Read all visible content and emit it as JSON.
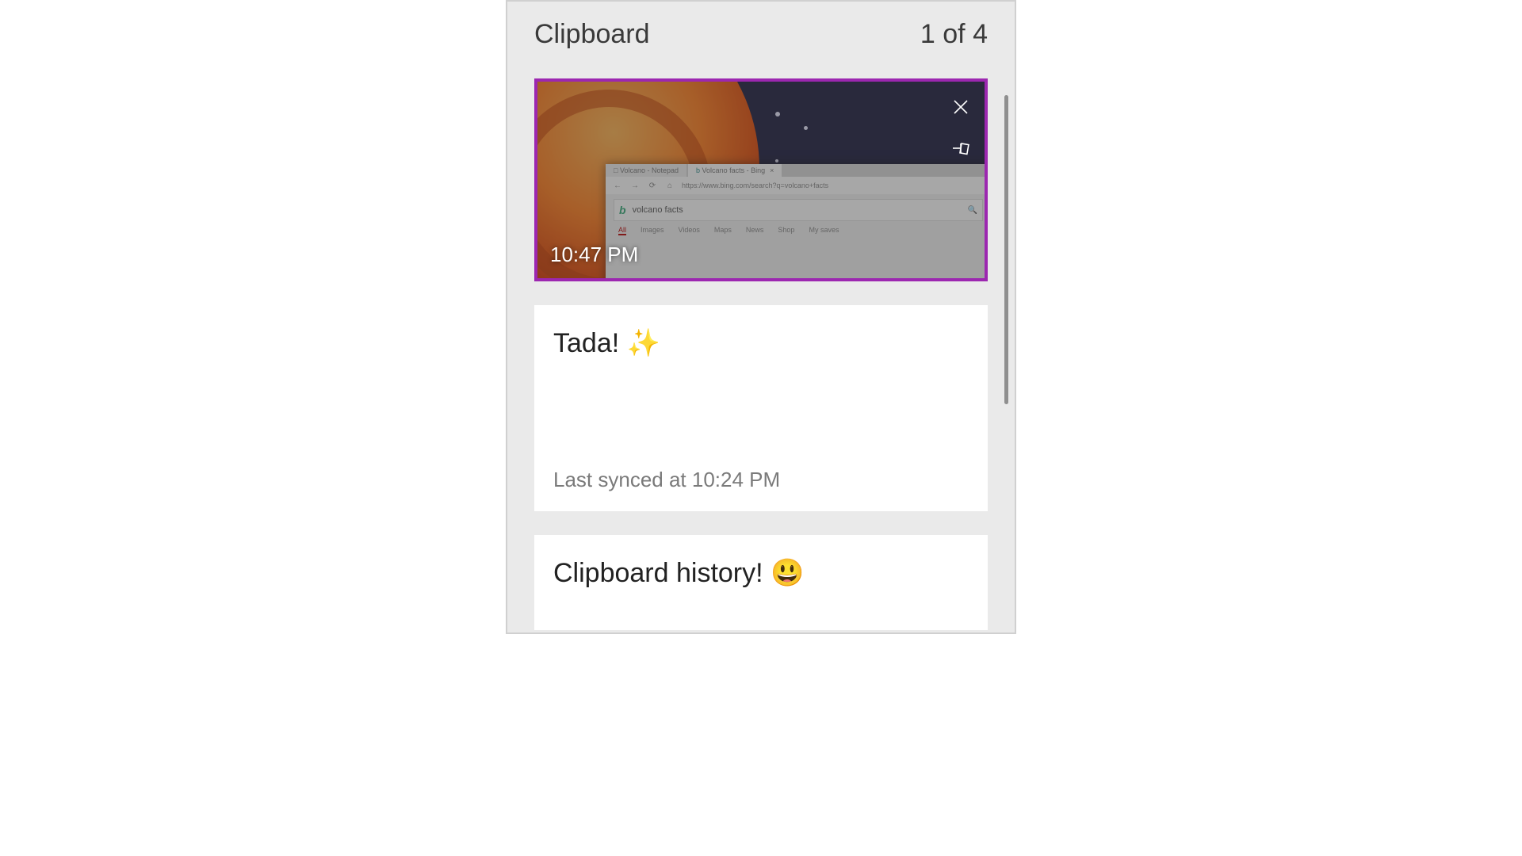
{
  "header": {
    "title": "Clipboard",
    "position": "1 of 4"
  },
  "clips": [
    {
      "type": "image",
      "timestamp": "10:47 PM",
      "icons": {
        "close": "close-icon",
        "pin": "pin-icon"
      },
      "thumb_browser": {
        "tabs": [
          "Volcano - Notepad",
          "Volcano facts - Bing"
        ],
        "tab_close": "×",
        "back": "←",
        "fwd": "→",
        "reload": "⟳",
        "home": "⌂",
        "url": "https://www.bing.com/search?q=volcano+facts",
        "logo": "b",
        "query": "volcano facts",
        "magnifier": "🔍",
        "nav": [
          "All",
          "Images",
          "Videos",
          "Maps",
          "News",
          "Shop",
          "My saves"
        ]
      }
    },
    {
      "type": "text",
      "content": "Tada! ✨",
      "subtext": "Last synced at 10:24 PM"
    },
    {
      "type": "text",
      "content": "Clipboard history! 😃"
    }
  ],
  "colors": {
    "selection_border": "#9c27b0",
    "panel_bg": "#eaeaea"
  }
}
